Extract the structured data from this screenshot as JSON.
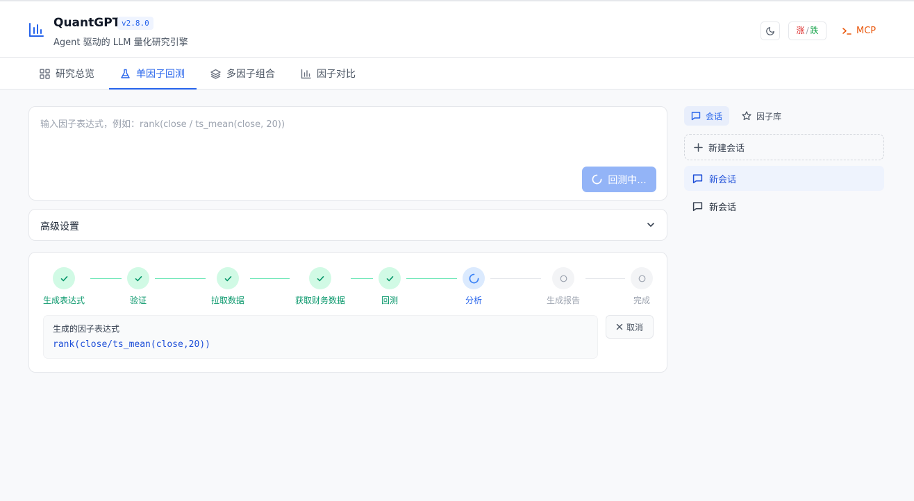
{
  "header": {
    "title": "QuantGPT",
    "version": "v2.8.0",
    "subtitle": "Agent 驱动的 LLM 量化研究引擎",
    "color_toggle": {
      "up": "涨",
      "separator": "/",
      "down": "跌"
    },
    "mcp_label": "MCP"
  },
  "tabs": [
    {
      "label": "研究总览",
      "icon": "grid-icon",
      "active": false
    },
    {
      "label": "单因子回测",
      "icon": "flask-icon",
      "active": true
    },
    {
      "label": "多因子组合",
      "icon": "layers-icon",
      "active": false
    },
    {
      "label": "因子对比",
      "icon": "bar-chart-icon",
      "active": false
    }
  ],
  "input": {
    "placeholder": "输入因子表达式，例如：rank(close / ts_mean(close, 20))",
    "value": "",
    "submit_label": "回测中..."
  },
  "settings": {
    "title": "高级设置"
  },
  "progress": {
    "steps": [
      {
        "label": "生成表达式",
        "status": "done"
      },
      {
        "label": "验证",
        "status": "done"
      },
      {
        "label": "拉取数据",
        "status": "done"
      },
      {
        "label": "获取财务数据",
        "status": "done"
      },
      {
        "label": "回测",
        "status": "done"
      },
      {
        "label": "分析",
        "status": "active"
      },
      {
        "label": "生成报告",
        "status": "pending"
      },
      {
        "label": "完成",
        "status": "pending"
      }
    ],
    "expression_label": "生成的因子表达式",
    "expression": "rank(close/ts_mean(close,20))",
    "cancel_label": "取消"
  },
  "sidebar": {
    "tabs": [
      {
        "label": "会话",
        "icon": "chat-icon",
        "active": true
      },
      {
        "label": "因子库",
        "icon": "star-icon",
        "active": false
      }
    ],
    "new_session_label": "新建会话",
    "sessions": [
      {
        "label": "新会话",
        "active": true
      },
      {
        "label": "新会话",
        "active": false
      }
    ]
  },
  "colors": {
    "accent": "#2563eb",
    "done": "#059669",
    "mcp": "#ea580c"
  }
}
